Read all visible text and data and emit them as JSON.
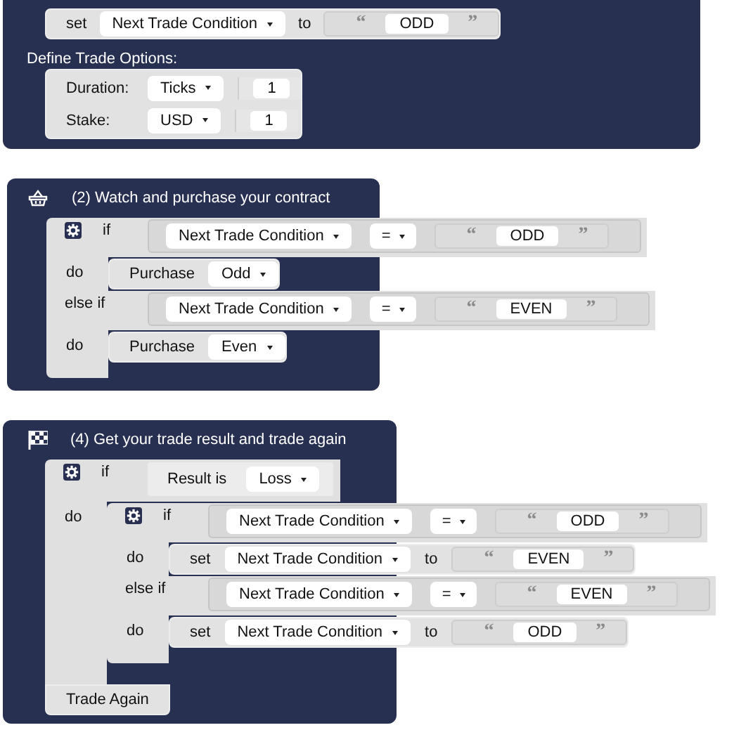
{
  "groups": [
    {
      "statements": [
        {
          "kind": "set",
          "keyword": "set",
          "variable": "Next Trade Condition",
          "to": "to",
          "value": {
            "open": "“",
            "text": "ODD",
            "close": "”"
          }
        },
        {
          "kind": "label",
          "text": "Define Trade Options:"
        },
        {
          "kind": "options",
          "rows": [
            {
              "label": "Duration:",
              "dropdown": "Ticks",
              "value": "1"
            },
            {
              "label": "Stake:",
              "dropdown": "USD",
              "value": "1"
            }
          ]
        }
      ]
    },
    {
      "title": "(2) Watch and purchase your contract",
      "statements": [
        {
          "kind": "if",
          "branches": [
            {
              "keyword": "if",
              "condition": {
                "kind": "compare",
                "variable": "Next Trade Condition",
                "operator": "=",
                "value": {
                  "open": "“",
                  "text": "ODD",
                  "close": "”"
                }
              },
              "do": "do",
              "body": [
                {
                  "kind": "purchase",
                  "label": "Purchase",
                  "dropdown": "Odd"
                }
              ]
            },
            {
              "keyword": "else if",
              "condition": {
                "kind": "compare",
                "variable": "Next Trade Condition",
                "operator": "=",
                "value": {
                  "open": "“",
                  "text": "EVEN",
                  "close": "”"
                }
              },
              "do": "do",
              "body": [
                {
                  "kind": "purchase",
                  "label": "Purchase",
                  "dropdown": "Even"
                }
              ]
            }
          ]
        }
      ]
    },
    {
      "title": "(4) Get your trade result and trade again",
      "statements": [
        {
          "kind": "if",
          "branches": [
            {
              "keyword": "if",
              "condition": {
                "kind": "result",
                "label": "Result is",
                "dropdown": "Loss"
              },
              "do": "do",
              "body": [
                {
                  "kind": "if",
                  "branches": [
                    {
                      "keyword": "if",
                      "condition": {
                        "kind": "compare",
                        "variable": "Next Trade Condition",
                        "operator": "=",
                        "value": {
                          "open": "“",
                          "text": "ODD",
                          "close": "”"
                        }
                      },
                      "do": "do",
                      "body": [
                        {
                          "kind": "set",
                          "keyword": "set",
                          "variable": "Next Trade Condition",
                          "to": "to",
                          "value": {
                            "open": "“",
                            "text": "EVEN",
                            "close": "”"
                          }
                        }
                      ]
                    },
                    {
                      "keyword": "else if",
                      "condition": {
                        "kind": "compare",
                        "variable": "Next Trade Condition",
                        "operator": "=",
                        "value": {
                          "open": "“",
                          "text": "EVEN",
                          "close": "”"
                        }
                      },
                      "do": "do",
                      "body": [
                        {
                          "kind": "set",
                          "keyword": "set",
                          "variable": "Next Trade Condition",
                          "to": "to",
                          "value": {
                            "open": "“",
                            "text": "ODD",
                            "close": "”"
                          }
                        }
                      ]
                    }
                  ]
                }
              ]
            }
          ]
        },
        {
          "kind": "trade_again",
          "label": "Trade Again"
        }
      ]
    }
  ]
}
